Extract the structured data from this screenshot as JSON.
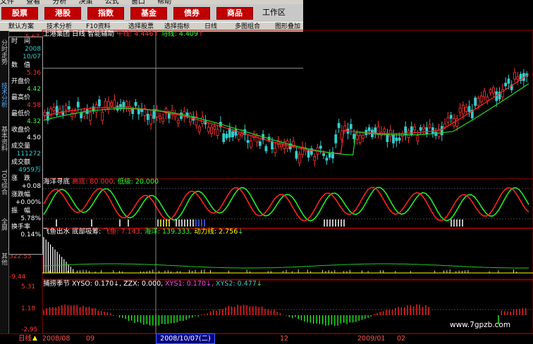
{
  "menu": [
    "文件",
    "查看",
    "分析",
    "决策",
    "公式",
    "窗口",
    "帮助"
  ],
  "toolbar": {
    "buttons": [
      "股票",
      "港股",
      "指数",
      "基金",
      "债券",
      "商品"
    ],
    "workzone": "工作区"
  },
  "window_bar": {
    "items": [
      "默认方案",
      "技术分析",
      "F10资料",
      "选择股票",
      "选择指标",
      "日线",
      "多图组合",
      "图形叠加"
    ]
  },
  "side_tabs": [
    "分时走势",
    "技术分析",
    "基本资料",
    "TOP综合",
    "全屏",
    "其他"
  ],
  "info_panel": {
    "rows": [
      {
        "label": "时　间",
        "value": "2008",
        "value2": "10/07"
      },
      {
        "label": "数　值",
        "value": "5.36"
      },
      {
        "label": "开盘价",
        "value": "4.42"
      },
      {
        "label": "最高价",
        "value": "4.58"
      },
      {
        "label": "最低价",
        "value": "4.32"
      },
      {
        "label": "收盘价",
        "value": "4.50"
      },
      {
        "label": "成交量",
        "value": "111272"
      },
      {
        "label": "成交额",
        "value": "4959万"
      },
      {
        "label": "涨　跌",
        "value": "+0.08"
      },
      {
        "label": "涨跌幅",
        "value": "+0.00%"
      },
      {
        "label": "振　幅",
        "value": "5.78%"
      },
      {
        "label": "换手率",
        "value": "0.14%"
      }
    ]
  },
  "main_panel": {
    "stock": "上港集团",
    "period": "日线",
    "indicator": "智能辅助",
    "ma1_label": "牛线:",
    "ma1_value": "4.446",
    "ma2_label": "马线:",
    "ma2_value": "4.409",
    "axis_top": "5.67"
  },
  "panel2": {
    "name": "海洋寻底",
    "high_label": "高底:",
    "high_value": "80.000,",
    "low_label": "低级:",
    "low_value": "20.000",
    "axis_mid": "80.00"
  },
  "panel3": {
    "name": "飞鱼出水",
    "sub": "底部吸筹:",
    "fish_label": "飞鱼:",
    "fish_value": "7.143,",
    "ocean_label": "海洋:",
    "ocean_value": "139.333,",
    "power_label": "动力线:",
    "power_value": "2.756",
    "axis_top": "322.55",
    "axis_bottom": "-9.44"
  },
  "panel4": {
    "name": "捕捞季节",
    "x1_label": "XYSO:",
    "x1_value": "0.170",
    "zzx_label": "ZZX:",
    "zzx_value": "0.000,",
    "xys1_label": "XYS1:",
    "xys1_value": "0.170",
    "xys2_label": "XYS2:",
    "xys2_value": "0.477",
    "axis_top": "5.31",
    "axis_mid": "1.18",
    "axis_bottom": "-2.95"
  },
  "footer": {
    "mode": "日线",
    "dates": [
      "2008/08",
      "09",
      "12",
      "2009/01",
      "02"
    ],
    "cursor_date": "2008/10/07(二)"
  },
  "watermark": "www.7gpzb.com",
  "colors": {
    "up": "#ff3333",
    "down": "#33cccc",
    "ma_red": "#ff2222",
    "ma_green": "#22cc22",
    "panel_border": "#990000"
  }
}
